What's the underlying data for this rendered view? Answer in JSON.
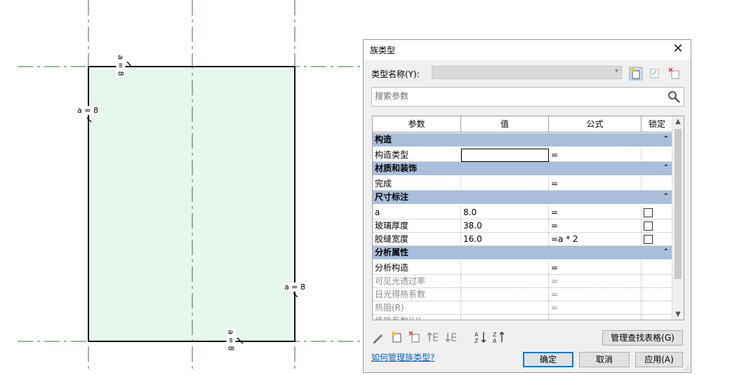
{
  "canvas": {
    "dimension_label": "a = 8",
    "fill_color": "#e6f7ec",
    "ref_line_color": "#2a7a2a"
  },
  "dialog": {
    "title": "族类型",
    "close_glyph": "✕",
    "type_name_label": "类型名称(Y):",
    "type_name_value": "",
    "search_placeholder": "搜索参数",
    "columns": [
      "参数",
      "值",
      "公式",
      "锁定"
    ],
    "groups": [
      {
        "name": "构造",
        "rows": [
          {
            "param": "构造类型",
            "value": "",
            "formula": "=",
            "lock": false,
            "show_lock": false,
            "disabled": false,
            "active_value": true
          }
        ]
      },
      {
        "name": "材质和装饰",
        "rows": [
          {
            "param": "完成",
            "value": "",
            "formula": "=",
            "lock": false,
            "show_lock": false,
            "disabled": false
          }
        ]
      },
      {
        "name": "尺寸标注",
        "rows": [
          {
            "param": "a",
            "value": "8.0",
            "formula": "=",
            "lock": false,
            "show_lock": true,
            "disabled": false
          },
          {
            "param": "玻璃厚度",
            "value": "38.0",
            "formula": "=",
            "lock": false,
            "show_lock": true,
            "disabled": false
          },
          {
            "param": "胶缝宽度",
            "value": "16.0",
            "formula": "=a * 2",
            "lock": false,
            "show_lock": true,
            "disabled": false
          }
        ]
      },
      {
        "name": "分析属性",
        "rows": [
          {
            "param": "分析构造",
            "value": "",
            "formula": "=",
            "lock": false,
            "show_lock": false,
            "disabled": false
          },
          {
            "param": "可见光透过率",
            "value": "",
            "formula": "=",
            "lock": false,
            "show_lock": false,
            "disabled": true
          },
          {
            "param": "日光得热系数",
            "value": "",
            "formula": "=",
            "lock": false,
            "show_lock": false,
            "disabled": true
          },
          {
            "param": "热阻(R)",
            "value": "",
            "formula": "=",
            "lock": false,
            "show_lock": false,
            "disabled": true
          },
          {
            "param": "传热系数(U)",
            "value": "",
            "formula": "=",
            "lock": false,
            "show_lock": false,
            "disabled": true
          }
        ]
      }
    ],
    "manage_lookup_label": "管理查找表格(G)",
    "help_link": "如何管理族类型?",
    "ok_label": "确定",
    "cancel_label": "取消",
    "apply_label": "应用(A)"
  }
}
